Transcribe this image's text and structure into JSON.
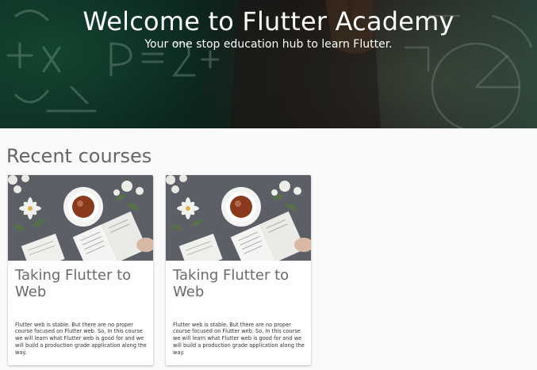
{
  "hero": {
    "title": "Welcome to Flutter Academy",
    "subtitle": "Your one stop education hub to learn Flutter."
  },
  "section": {
    "title": "Recent courses"
  },
  "courses": [
    {
      "title": "Taking Flutter to Web",
      "description": "Flutter web is stable. But there are no proper course focused on Flutter web. So, In this course we will learn what Flutter web is good for and we will build a production grade application along the way.",
      "image": "course-thumbnail-coffee-book-flowers"
    },
    {
      "title": "Taking Flutter to Web",
      "description": "Flutter web is stable. But there are no proper course focused on Flutter web. So, In this course we will learn what Flutter web is good for and we will build a production grade application along the way.",
      "image": "course-thumbnail-coffee-book-flowers"
    }
  ],
  "colors": {
    "page_background": "#fafafa",
    "hero_chalkboard": "#123a2c",
    "section_title": "#666666",
    "card_title": "#6a6a6a"
  }
}
